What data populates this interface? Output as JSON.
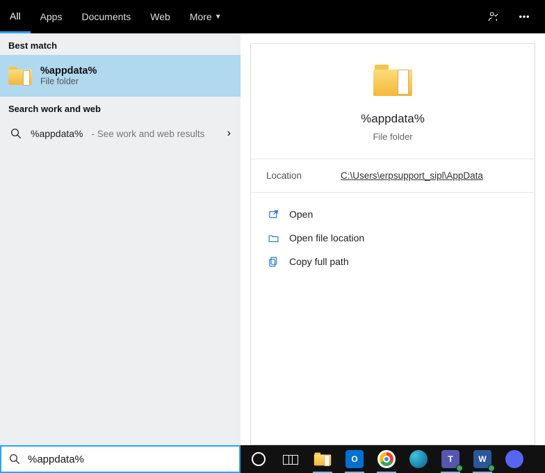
{
  "tabs": {
    "all": "All",
    "apps": "Apps",
    "documents": "Documents",
    "web": "Web",
    "more": "More"
  },
  "left": {
    "best_match_header": "Best match",
    "result": {
      "title": "%appdata%",
      "subtitle": "File folder"
    },
    "work_web_header": "Search work and web",
    "web_result": {
      "query": "%appdata%",
      "hint": " - See work and web results"
    }
  },
  "preview": {
    "name": "%appdata%",
    "type": "File folder",
    "location_label": "Location",
    "location_value": "C:\\Users\\erpsupport_sipl\\AppData",
    "actions": {
      "open": "Open",
      "open_location": "Open file location",
      "copy_path": "Copy full path"
    }
  },
  "search": {
    "value": "%appdata%"
  },
  "taskbar": {
    "explorer_color": "#f8c24b",
    "outlook_color": "#0070d4",
    "chrome_colors": [
      "#ea4335",
      "#4285f4",
      "#34a853",
      "#fbbc05"
    ],
    "edge_color": "#1b8f8a",
    "teams_color": "#5557af",
    "word_color": "#2b579a",
    "discord_color": "#5865f2"
  }
}
